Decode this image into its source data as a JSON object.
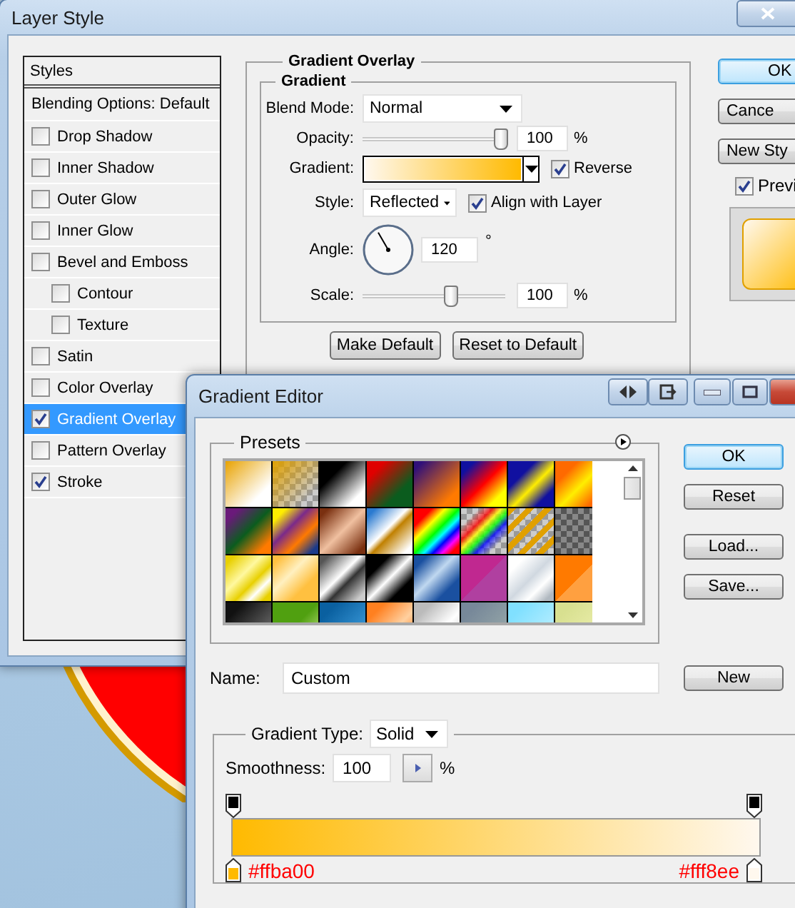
{
  "layer_style": {
    "title": "Layer Style",
    "styles": {
      "header": "Styles",
      "blending_options": {
        "label": "Blending Options: Default",
        "selected": false
      },
      "effects": [
        {
          "label": "Drop Shadow",
          "checked": false,
          "selected": false
        },
        {
          "label": "Inner Shadow",
          "checked": false,
          "selected": false
        },
        {
          "label": "Outer Glow",
          "checked": false,
          "selected": false
        },
        {
          "label": "Inner Glow",
          "checked": false,
          "selected": false
        },
        {
          "label": "Bevel and Emboss",
          "checked": false,
          "selected": false,
          "children": [
            {
              "label": "Contour",
              "checked": false,
              "selected": false
            },
            {
              "label": "Texture",
              "checked": false,
              "selected": false
            }
          ]
        },
        {
          "label": "Satin",
          "checked": false,
          "selected": false
        },
        {
          "label": "Color Overlay",
          "checked": false,
          "selected": false
        },
        {
          "label": "Gradient Overlay",
          "checked": true,
          "selected": true
        },
        {
          "label": "Pattern Overlay",
          "checked": false,
          "selected": false
        },
        {
          "label": "Stroke",
          "checked": true,
          "selected": false
        }
      ]
    },
    "gradient_overlay": {
      "title": "Gradient Overlay",
      "section": "Gradient",
      "blend_mode": {
        "label": "Blend Mode:",
        "value": "Normal"
      },
      "opacity": {
        "label": "Opacity:",
        "level": 0.97,
        "value": "100",
        "unit": "%"
      },
      "gradient": {
        "label": "Gradient:"
      },
      "reverse": {
        "label": "Reverse",
        "checked": true
      },
      "style": {
        "label": "Style:",
        "value": "Reflected"
      },
      "align_with_layer": {
        "label": "Align with Layer",
        "checked": true
      },
      "angle": {
        "label": "Angle:",
        "value": "120",
        "unit": "°"
      },
      "scale": {
        "label": "Scale:",
        "level": 0.62,
        "value": "100",
        "unit": "%"
      },
      "buttons": [
        "Make Default",
        "Reset to Default"
      ]
    },
    "actions": [
      {
        "label": "OK",
        "kind": "default"
      },
      {
        "label": "Cance",
        "kind": "normal"
      },
      {
        "label": "New Sty",
        "kind": "normal"
      }
    ],
    "preview": {
      "label": "Previ",
      "checked": true
    }
  },
  "gradient_editor": {
    "title": "Gradient Editor",
    "presets_title": "Presets",
    "actions": [
      {
        "label": "OK",
        "kind": "default"
      },
      {
        "label": "Reset",
        "kind": "normal"
      },
      {
        "label": "Load...",
        "kind": "normal"
      },
      {
        "label": "Save...",
        "kind": "normal"
      }
    ],
    "name": {
      "label": "Name:",
      "value": "Custom"
    },
    "new_button": "New",
    "gradient_type": {
      "label": "Gradient Type:",
      "value": "Solid"
    },
    "smoothness": {
      "label": "Smoothness:",
      "value": "100",
      "unit": "%"
    },
    "color_stops": [
      {
        "label": "#ffba00",
        "color": "#ffba00"
      },
      {
        "label": "#fff8ee",
        "color": "#fff8ee"
      }
    ]
  }
}
